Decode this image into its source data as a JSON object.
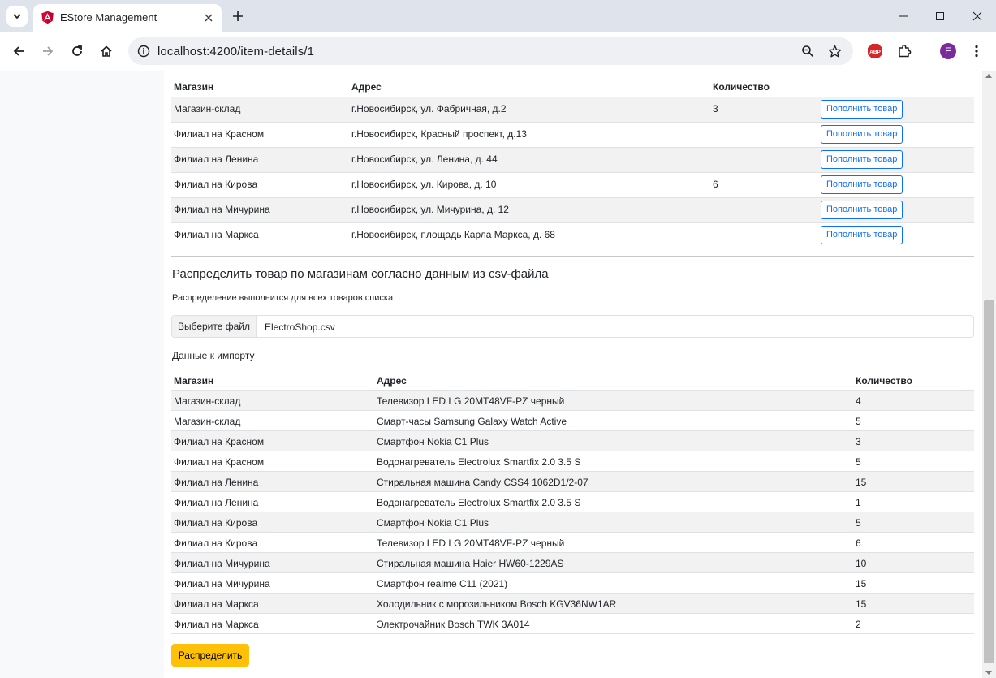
{
  "browser": {
    "tab_title": "EStore Management",
    "url": "localhost:4200/item-details/1",
    "profile_initial": "E",
    "extension_badge": "ABP",
    "icons": [
      "tab-search-icon",
      "angular-favicon",
      "close-icon",
      "plus-icon",
      "minimize-icon",
      "maximize-icon",
      "back-icon",
      "forward-icon",
      "reload-icon",
      "home-icon",
      "site-info-icon",
      "zoom-icon",
      "star-icon",
      "extensions-icon",
      "menu-icon"
    ]
  },
  "stock_table": {
    "headers": [
      "Магазин",
      "Адрес",
      "Количество",
      ""
    ],
    "refill_label": "Пополнить товар",
    "rows": [
      {
        "store": "Магазин-склад",
        "address": "г.Новосибирск, ул. Фабричная, д.2",
        "qty": "3"
      },
      {
        "store": "Филиал на Красном",
        "address": "г.Новосибирск, Красный проспект, д.13",
        "qty": ""
      },
      {
        "store": "Филиал на Ленина",
        "address": "г.Новосибирск, ул. Ленина, д. 44",
        "qty": ""
      },
      {
        "store": "Филиал на Кирова",
        "address": "г.Новосибирск, ул. Кирова, д. 10",
        "qty": "6"
      },
      {
        "store": "Филиал на Мичурина",
        "address": "г.Новосибирск, ул. Мичурина, д. 12",
        "qty": ""
      },
      {
        "store": "Филиал на Марксa",
        "address": "г.Новосибирск, площадь Карла Маркса, д. 68",
        "qty": ""
      }
    ]
  },
  "distribution": {
    "title": "Распределить товар по магазинам согласно данным из csv-файла",
    "note": "Распределение выполнится для всех товаров списка",
    "file_button": "Выберите файл",
    "file_name": "ElectroShop.csv",
    "import_label": "Данные к импорту",
    "submit_label": "Распределить"
  },
  "import_table": {
    "headers": [
      "Магазин",
      "Адрес",
      "Количество"
    ],
    "rows": [
      {
        "store": "Магазин-склад",
        "address": "Телевизор LED LG 20MT48VF-PZ черный",
        "qty": "4"
      },
      {
        "store": "Магазин-склад",
        "address": "Смарт-часы Samsung Galaxy Watch Active",
        "qty": "5"
      },
      {
        "store": "Филиал на Красном",
        "address": "Смартфон Nokia C1 Plus",
        "qty": "3"
      },
      {
        "store": "Филиал на Красном",
        "address": "Водонагреватель Electrolux Smartfix 2.0 3.5 S",
        "qty": "5"
      },
      {
        "store": "Филиал на Ленина",
        "address": "Стиральная машина Candy CSS4 1062D1/2-07",
        "qty": "15"
      },
      {
        "store": "Филиал на Ленина",
        "address": "Водонагреватель Electrolux Smartfix 2.0 3.5 S",
        "qty": "1"
      },
      {
        "store": "Филиал на Кирова",
        "address": "Смартфон Nokia C1 Plus",
        "qty": "5"
      },
      {
        "store": "Филиал на Кирова",
        "address": "Телевизор LED LG 20MT48VF-PZ черный",
        "qty": "6"
      },
      {
        "store": "Филиал на Мичурина",
        "address": "Стиральная машина Haier HW60-1229AS",
        "qty": "10"
      },
      {
        "store": "Филиал на Мичурина",
        "address": "Смартфон realme C11 (2021)",
        "qty": "15"
      },
      {
        "store": "Филиал на Маркса",
        "address": "Холодильник с морозильником Bosch KGV36NW1AR",
        "qty": "15"
      },
      {
        "store": "Филиал на Маркса",
        "address": "Электрочайник Bosch TWK 3A014",
        "qty": "2"
      }
    ]
  },
  "colors": {
    "primary": "#0d6efd",
    "warning": "#ffc107",
    "stripe": "#f2f2f2",
    "angular_red": "#dd0031"
  }
}
